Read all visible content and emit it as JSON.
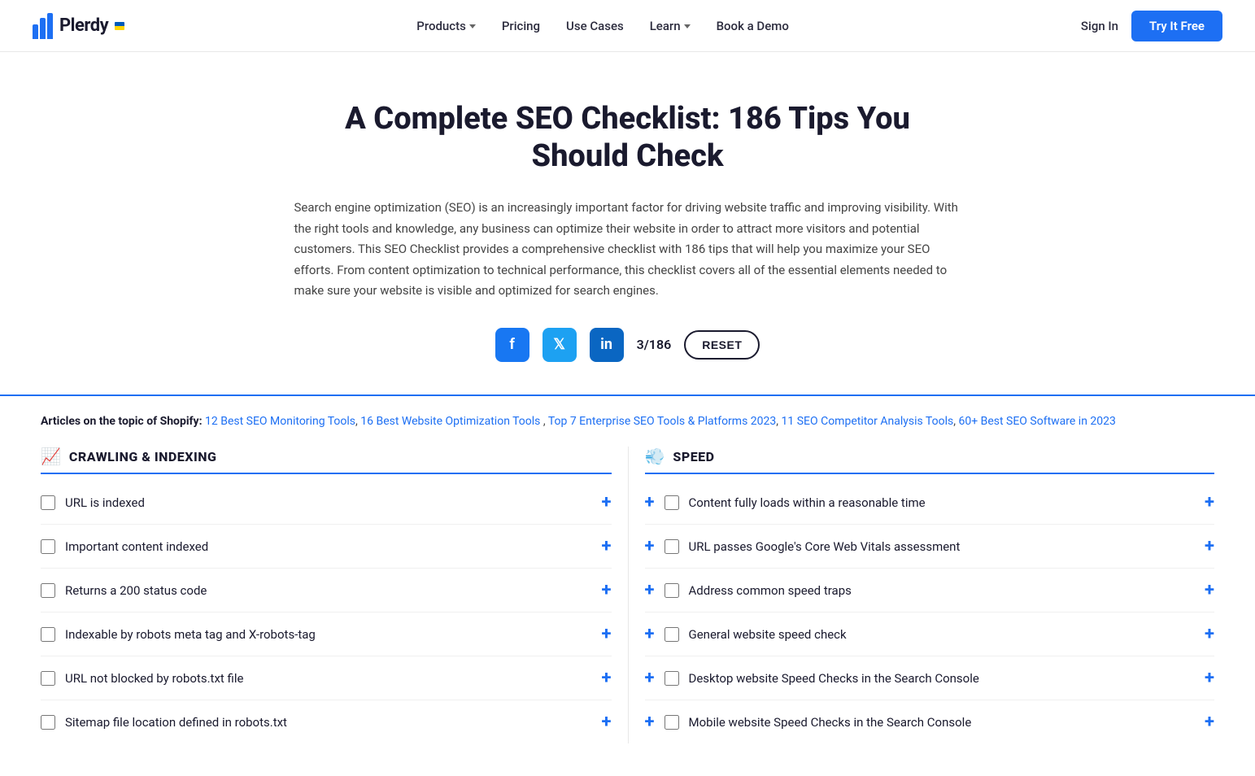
{
  "navbar": {
    "logo_text": "Plerdy",
    "nav_items": [
      {
        "label": "Products",
        "has_dropdown": true
      },
      {
        "label": "Pricing",
        "has_dropdown": false
      },
      {
        "label": "Use Cases",
        "has_dropdown": false
      },
      {
        "label": "Learn",
        "has_dropdown": true
      },
      {
        "label": "Book a Demo",
        "has_dropdown": false
      }
    ],
    "signin_label": "Sign In",
    "try_label": "Try It Free"
  },
  "hero": {
    "title": "A Complete SEO Checklist: 186 Tips You Should Check",
    "description": "Search engine optimization (SEO) is an increasingly important factor for driving website traffic and improving visibility. With the right tools and knowledge, any business can optimize their website in order to attract more visitors and potential customers. This SEO Checklist provides a comprehensive checklist with 186 tips that will help you maximize your SEO efforts. From content optimization to technical performance, this checklist covers all of the essential elements needed to make sure your website is visible and optimized for search engines.",
    "counter": "3/186",
    "reset_label": "RESET"
  },
  "articles": {
    "prefix": "Articles on the topic of Shopify:",
    "links": [
      "12 Best SEO Monitoring Tools",
      "16 Best Website Optimization Tools",
      "Top 7 Enterprise SEO Tools & Platforms 2023",
      "11 SEO Competitor Analysis Tools",
      "60+ Best SEO Software in 2023"
    ]
  },
  "crawling_section": {
    "title": "CRAWLING & INDEXING",
    "icon": "📈",
    "items": [
      "URL is indexed",
      "Important content indexed",
      "Returns a 200 status code",
      "Indexable by robots meta tag and X-robots-tag",
      "URL not blocked by robots.txt file",
      "Sitemap file location defined in robots.txt"
    ]
  },
  "speed_section": {
    "title": "SPEED",
    "icon": "💨",
    "items": [
      "Content fully loads within a reasonable time",
      "URL passes Google's Core Web Vitals assessment",
      "Address common speed traps",
      "General website speed check",
      "Desktop website Speed Checks in the Search Console",
      "Mobile website Speed Checks in the Search Console"
    ]
  }
}
